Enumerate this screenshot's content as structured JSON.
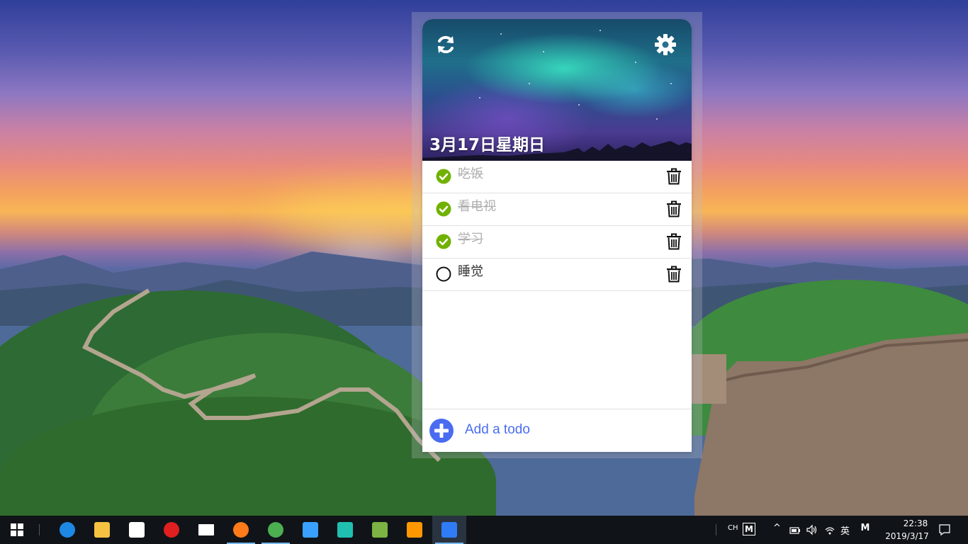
{
  "app": {
    "date_title": "3月17日星期日",
    "add_label": "Add a todo",
    "accent_color": "#4a6cf0",
    "check_color": "#71b100",
    "todos": [
      {
        "text": "吃饭",
        "done": true
      },
      {
        "text": "看电视",
        "done": true
      },
      {
        "text": "学习",
        "done": true
      },
      {
        "text": "睡觉",
        "done": false
      }
    ]
  },
  "taskbar": {
    "apps": [
      {
        "name": "edge-icon",
        "color": "#1e88e5"
      },
      {
        "name": "file-explorer-icon",
        "color": "#f5c242"
      },
      {
        "name": "store-icon",
        "color": "#ffffff"
      },
      {
        "name": "netease-music-icon",
        "color": "#e02020"
      },
      {
        "name": "mail-icon",
        "color": "#ffffff"
      },
      {
        "name": "firefox-icon",
        "color": "#ff7a18"
      },
      {
        "name": "chrome-icon",
        "color": "#4caf50"
      },
      {
        "name": "photos-icon",
        "color": "#3aa0ff"
      },
      {
        "name": "webstorm-icon",
        "color": "#20c0b0"
      },
      {
        "name": "notepad-icon",
        "color": "#7cb342"
      },
      {
        "name": "sublime-text-icon",
        "color": "#ff9800"
      },
      {
        "name": "todo-app-icon",
        "color": "#2f7cf6"
      }
    ],
    "tray": {
      "ime_mode": "CH",
      "ime_letter": "M",
      "lang": "英",
      "ime_letter_2": "M",
      "time": "22:38",
      "date": "2019/3/17"
    }
  }
}
